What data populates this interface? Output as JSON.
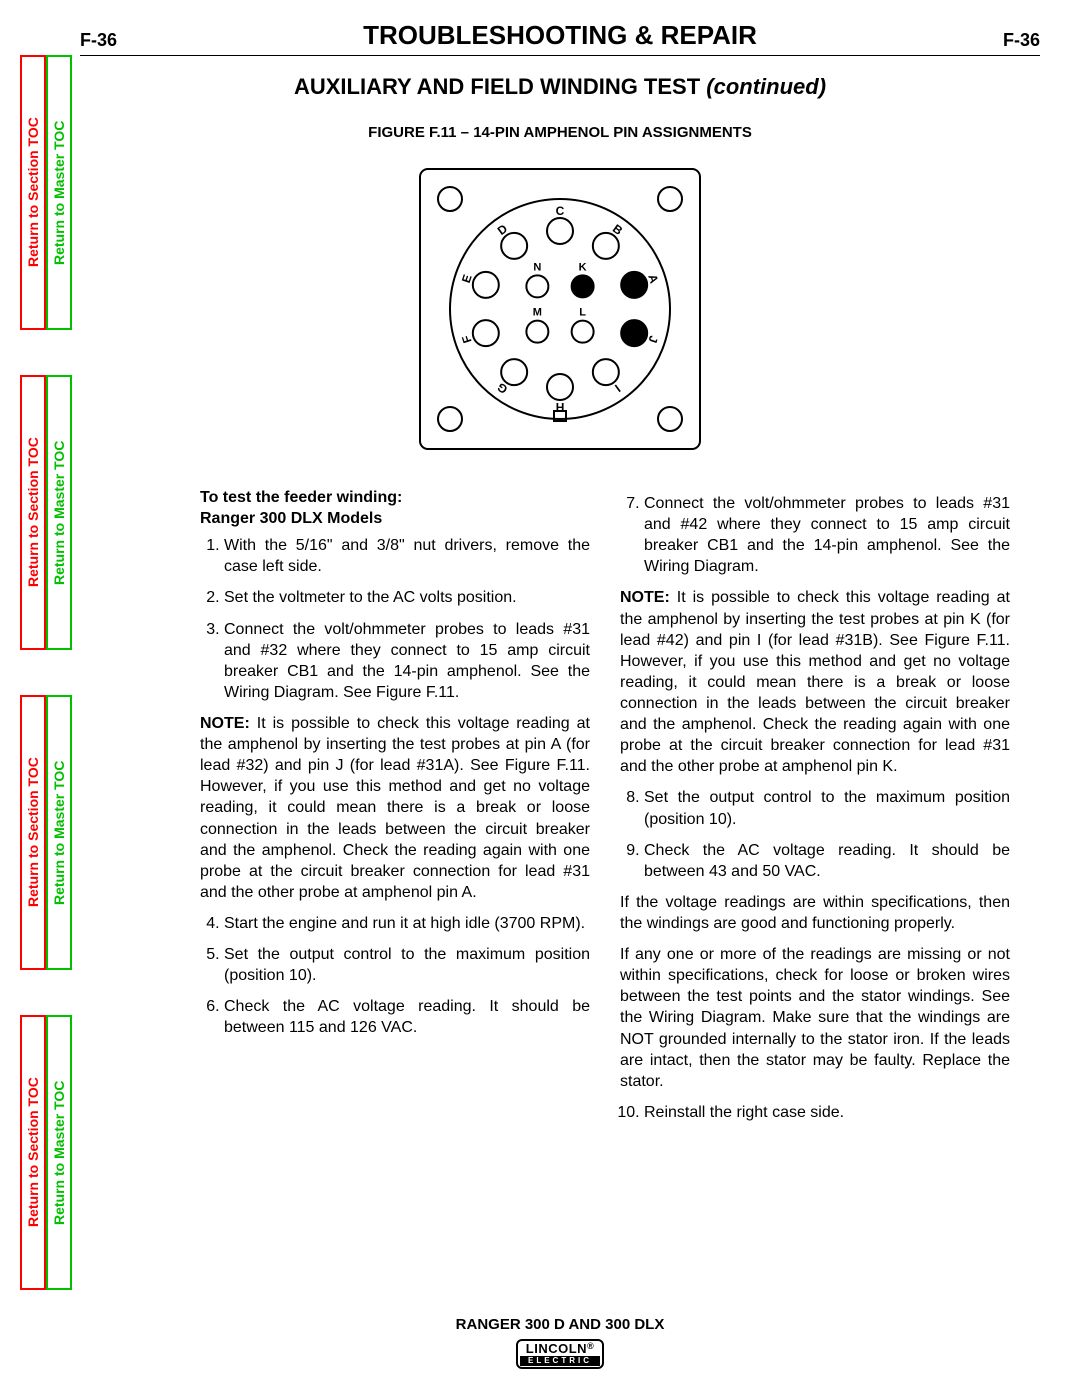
{
  "side_tabs": {
    "section": "Return to Section TOC",
    "master": "Return to Master TOC"
  },
  "header": {
    "page_left": "F-36",
    "page_right": "F-36",
    "title": "TROUBLESHOOTING & REPAIR"
  },
  "subtitle": {
    "text": "AUXILIARY AND FIELD WINDING TEST ",
    "cont": "(continued)"
  },
  "figure_caption": "FIGURE F.11 – 14-PIN AMPHENOL PIN ASSIGNMENTS",
  "diagram": {
    "pin_labels": [
      "A",
      "B",
      "C",
      "D",
      "E",
      "F",
      "G",
      "H",
      "I",
      "J",
      "K",
      "L",
      "M",
      "N"
    ]
  },
  "left_col": {
    "lead1": "To test the feeder winding:",
    "lead2": "Ranger 300 DLX Models",
    "items_1_3": [
      "With the 5/16\" and 3/8\" nut drivers, remove the case left side.",
      "Set the voltmeter to the AC volts position.",
      "Connect the volt/ohmmeter probes to leads #31 and #32 where they connect to 15 amp circuit breaker CB1 and the 14-pin amphenol. See the Wiring Diagram. See Figure F.11."
    ],
    "note1_label": "NOTE:",
    "note1": " It is possible to check this voltage reading at the amphenol by inserting the test probes at pin A (for lead #32) and pin J (for lead #31A). See Figure F.11. However, if you use this method and get no voltage reading, it could mean there is a break or loose connection in the leads between the circuit breaker and the amphenol. Check the reading again with one probe at the circuit breaker connection for lead #31 and the other probe at amphenol pin A.",
    "items_4_6": [
      "Start the engine and run it at high idle (3700 RPM).",
      "Set the output control to the maximum position (position 10).",
      "Check the AC voltage reading. It should be between 115 and 126 VAC."
    ]
  },
  "right_col": {
    "items_7": [
      "Connect the volt/ohmmeter probes to leads #31 and #42 where they connect to 15 amp circuit breaker CB1 and the 14-pin amphenol. See the Wiring Diagram."
    ],
    "note2_label": "NOTE:",
    "note2": " It is possible to check this voltage reading at the amphenol by inserting the test probes at pin K (for lead #42) and pin I (for lead #31B). See Figure F.11. However, if you use this method and get no voltage reading, it could mean there is a break or loose connection in the leads between the circuit breaker and the amphenol. Check the reading again with one probe at the circuit breaker connection for lead #31 and the other probe at amphenol pin K.",
    "items_8_9": [
      "Set the output control to the maximum position (position 10).",
      "Check the AC voltage reading. It should be between 43 and 50 VAC."
    ],
    "para_ok": "If the voltage readings are within specifications, then the windings are good and functioning properly.",
    "para_bad": "If any one or more of the readings are missing or not within specifications, check for loose or broken wires between the test points and the stator windings. See the Wiring Diagram. Make sure that the windings are NOT grounded internally to the stator iron. If the leads are intact, then the stator may be faulty. Replace the stator.",
    "items_10": [
      "Reinstall the right case side."
    ]
  },
  "footer": {
    "model": "RANGER 300 D AND 300 DLX",
    "logo_top": "LINCOLN",
    "logo_reg": "®",
    "logo_bottom": "ELECTRIC"
  }
}
